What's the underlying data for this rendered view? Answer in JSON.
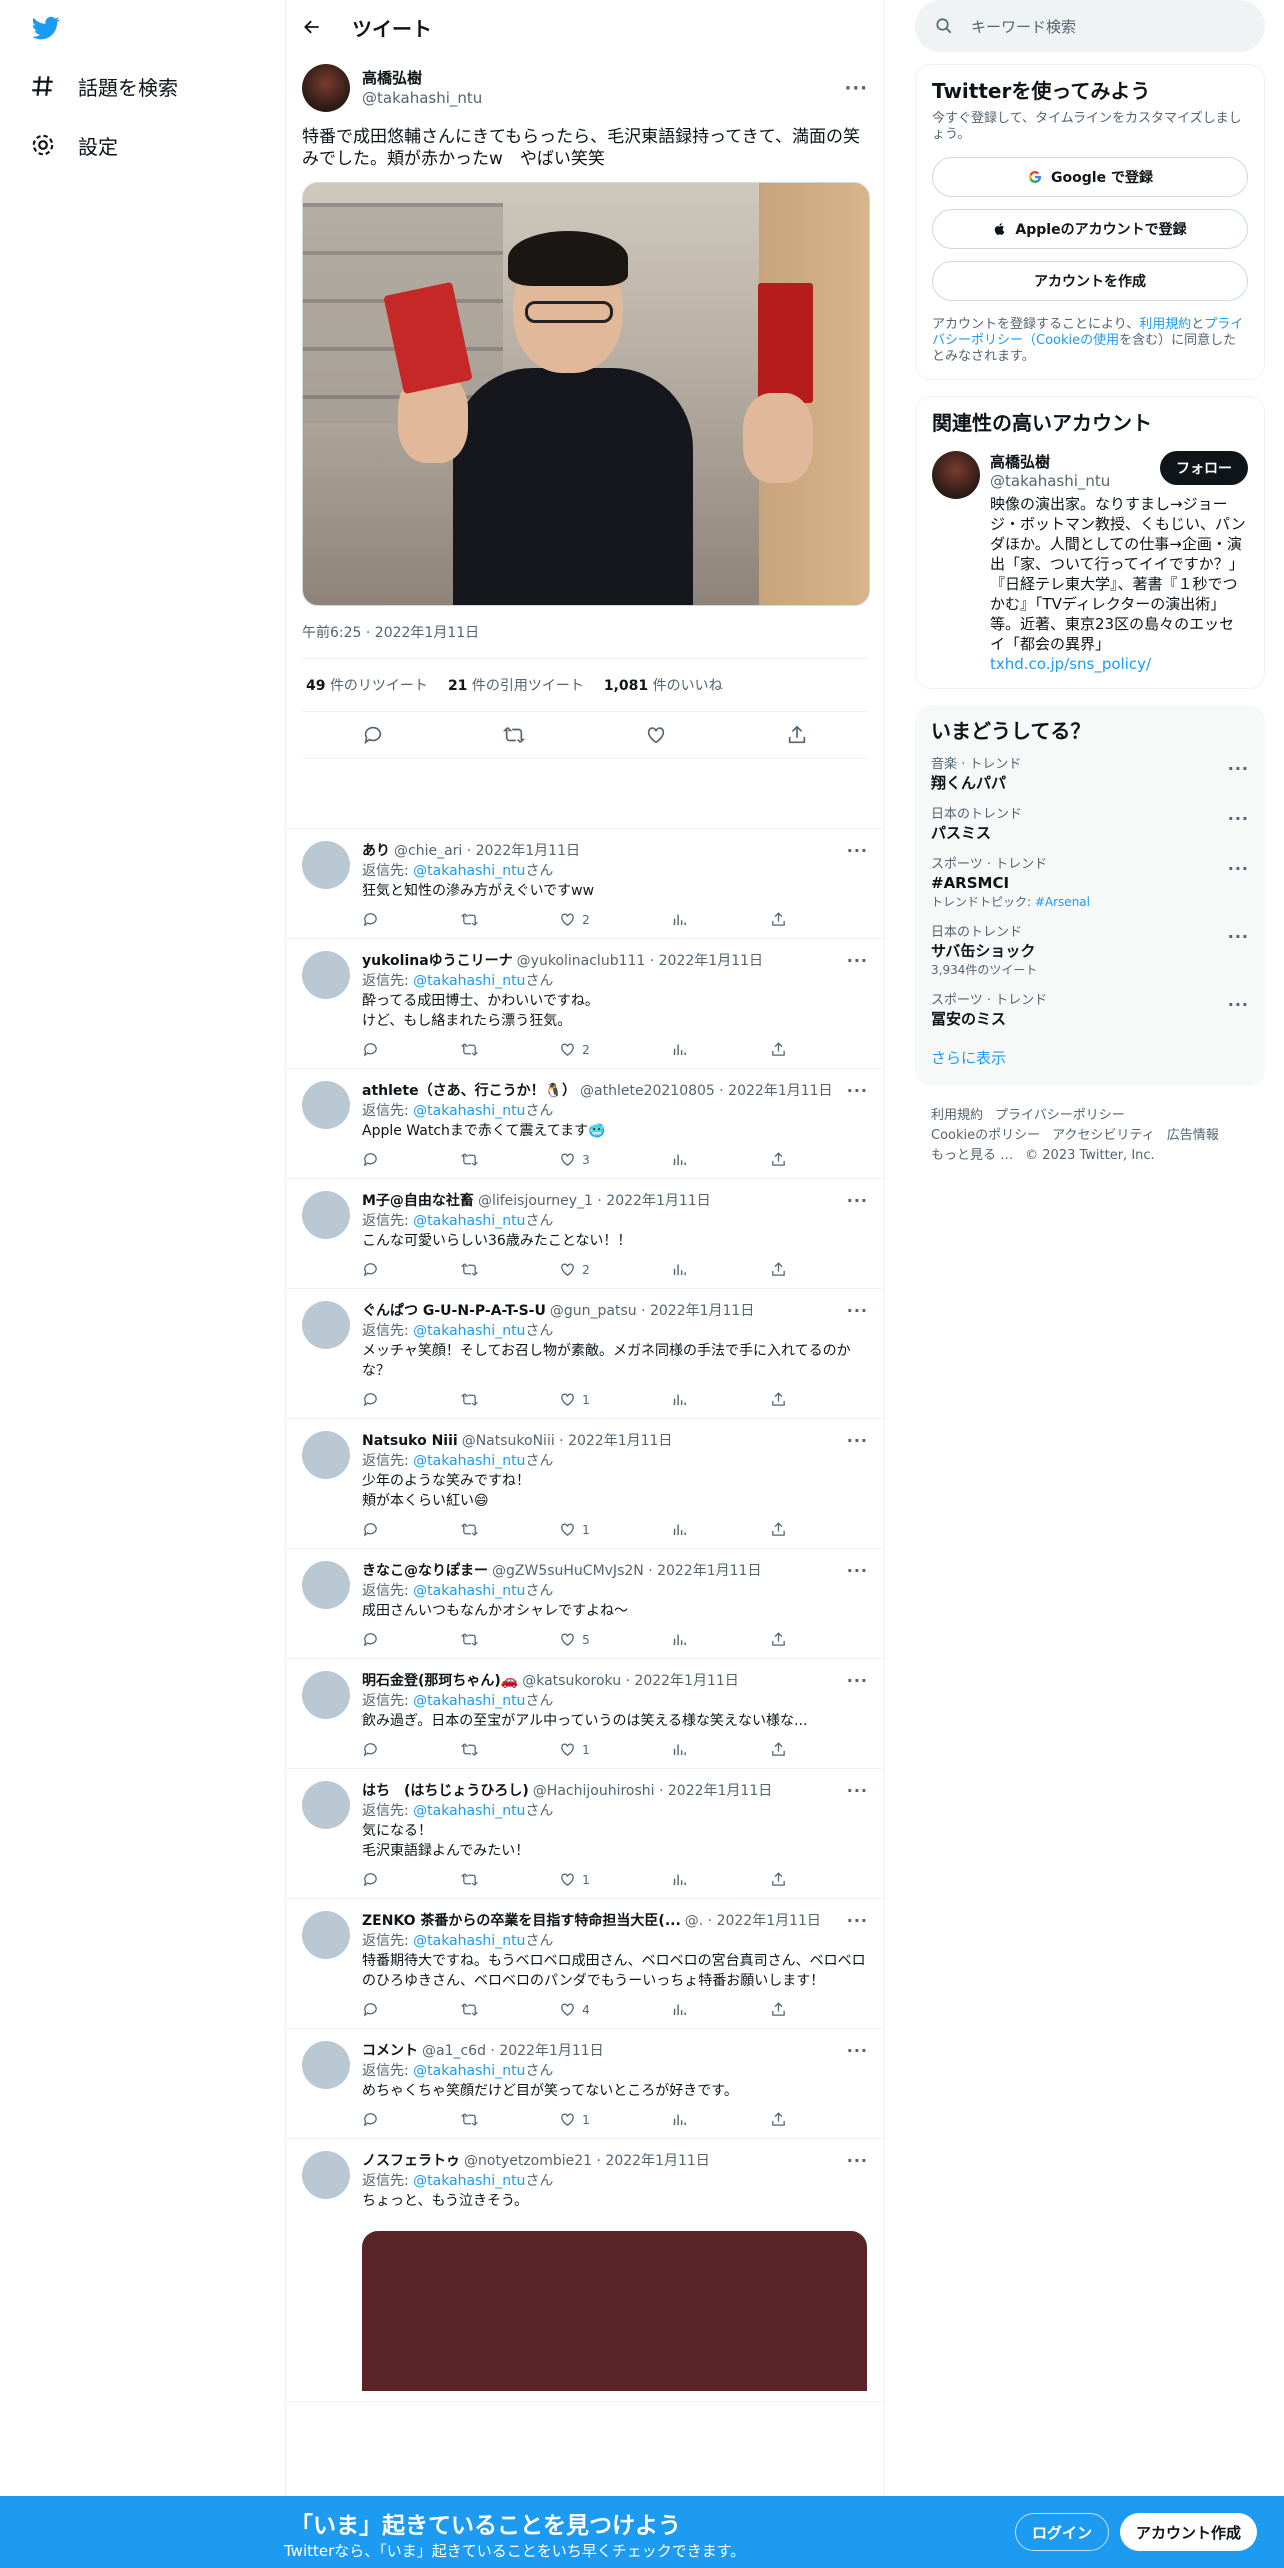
{
  "nav": {
    "explore": "話題を検索",
    "settings": "設定"
  },
  "header": {
    "title": "ツイート"
  },
  "main_tweet": {
    "name": "高橋弘樹",
    "handle": "@takahashi_ntu",
    "text": "特番で成田悠輔さんにきてもらったら、毛沢東語録持ってきて、満面の笑みでした。頬が赤かったw　やばい笑笑",
    "time": "午前6:25 · 2022年1月11日",
    "retweets": "49",
    "retweets_label": "件のリツイート",
    "quotes": "21",
    "quotes_label": "件の引用ツイート",
    "likes": "1,081",
    "likes_label": "件のいいね"
  },
  "replying_to_label": "返信先:",
  "replying_to_handle": "@takahashi_ntu",
  "replying_to_suffix": "さん",
  "replies": [
    {
      "name": "あり",
      "meta": "@chie_ari · 2022年1月11日",
      "text": "狂気と知性の滲み方がえぐいですww",
      "likes": "2"
    },
    {
      "name": "yukolinaゆうこリーナ",
      "meta": "@yukolinaclub111 · 2022年1月11日",
      "text": "酔ってる成田博士、かわいいですね。\nけど、もし絡まれたら漂う狂気。",
      "likes": "2"
    },
    {
      "name": "athlete（さあ、行こうか！🐧）",
      "meta": "@athlete20210805 · 2022年1月11日",
      "text": "Apple Watchまで赤くて震えてます🥶",
      "likes": "3"
    },
    {
      "name": "M子@自由な社畜",
      "meta": "@lifeisjourney_1 · 2022年1月11日",
      "text": "こんな可愛いらしい36歳みたことない！！",
      "likes": "2"
    },
    {
      "name": "ぐんぱつ G-U-N-P-A-T-S-U",
      "meta": "@gun_patsu · 2022年1月11日",
      "text": "メッチャ笑顔！そしてお召し物が素敵。メガネ同様の手法で手に入れてるのかな？",
      "likes": "1"
    },
    {
      "name": "Natsuko Niii",
      "meta": "@NatsukoNiii · 2022年1月11日",
      "text": "少年のような笑みですね！\n頬が本くらい紅い😄",
      "likes": "1"
    },
    {
      "name": "きなこ@なりぽまー",
      "meta": "@gZW5suHuCMvJs2N · 2022年1月11日",
      "text": "成田さんいつもなんかオシャレですよね〜",
      "likes": "5"
    },
    {
      "name": "明石金登(那珂ちゃん)🚗",
      "meta": "@katsukoroku · 2022年1月11日",
      "text": "飲み過ぎ。日本の至宝がアル中っていうのは笑える様な笑えない様な...",
      "likes": "1"
    },
    {
      "name": "はち　(はちじょうひろし)",
      "meta": "@Hachijouhiroshi · 2022年1月11日",
      "text": "気になる！\n毛沢東語録よんでみたい！",
      "likes": "1"
    },
    {
      "name": "ZENKO 茶番からの卒業を目指す特命担当大臣(...",
      "meta": "@. · 2022年1月11日",
      "text": "特番期待大ですね。もうベロベロ成田さん、ベロベロの宮台真司さん、ベロベロのひろゆきさん、ベロベロのパンダでもうーいっちょ特番お願いします！",
      "likes": "4"
    },
    {
      "name": "コメント",
      "meta": "@a1_c6d · 2022年1月11日",
      "text": "めちゃくちゃ笑顔だけど目が笑ってないところが好きです。",
      "likes": "1"
    },
    {
      "name": "ノスフェラトゥ",
      "meta": "@notyetzombie21 · 2022年1月11日",
      "text": "ちょっと、もう泣きそう。",
      "likes": ""
    }
  ],
  "right": {
    "search_placeholder": "キーワード検索",
    "signup_card": {
      "title": "Twitterを使ってみよう",
      "sub": "今すぐ登録して、タイムラインをカスタマイズしましょう。",
      "google": "Google で登録",
      "apple": "Appleのアカウントで登録",
      "create": "アカウントを作成",
      "legal_1": "アカウントを登録することにより、",
      "legal_link1": "利用規約",
      "legal_2": "と",
      "legal_link2": "プライバシーポリシー（Cookieの使用",
      "legal_3": "を含む）に同意したとみなされます。"
    },
    "related": {
      "title": "関連性の高いアカウント",
      "name": "高橋弘樹",
      "handle": "@takahashi_ntu",
      "follow": "フォロー",
      "bio": "映像の演出家。なりすまし→ジョージ・ボットマン教授、くもじい、パンダほか。人間としての仕事→企画・演出「家、ついて行ってイイですか？」『日経テレ東大学』、著書『１秒でつかむ』「TVディレクターの演出術」等。近著、東京23区の島々のエッセイ「都会の異界」",
      "bio_link": "txhd.co.jp/sns_policy/"
    },
    "trends": {
      "title": "いまどうしてる？",
      "items": [
        {
          "cat": "音楽 · トレンド",
          "name": "翔くんパパ",
          "extra": ""
        },
        {
          "cat": "日本のトレンド",
          "name": "パスミス",
          "extra": ""
        },
        {
          "cat": "スポーツ · トレンド",
          "name": "#ARSMCI",
          "extra": "トレンドトピック: ",
          "extra_link": "#Arsenal"
        },
        {
          "cat": "日本のトレンド",
          "name": "サバ缶ショック",
          "extra": "3,934件のツイート"
        },
        {
          "cat": "スポーツ · トレンド",
          "name": "冨安のミス",
          "extra": ""
        }
      ],
      "show_more": "さらに表示"
    },
    "footer": [
      "利用規約",
      "プライバシーポリシー",
      "Cookieのポリシー",
      "アクセシビリティ",
      "広告情報",
      "もっと見る …",
      "© 2023 Twitter, Inc."
    ]
  },
  "bottom_bar": {
    "title": "「いま」起きていることを見つけよう",
    "sub": "Twitterなら、「いま」起きていることをいち早くチェックできます。",
    "login": "ログイン",
    "signup": "アカウント作成"
  },
  "colors": {
    "accent": "#1d9bf0",
    "text": "#0f1419",
    "muted": "#536471"
  }
}
